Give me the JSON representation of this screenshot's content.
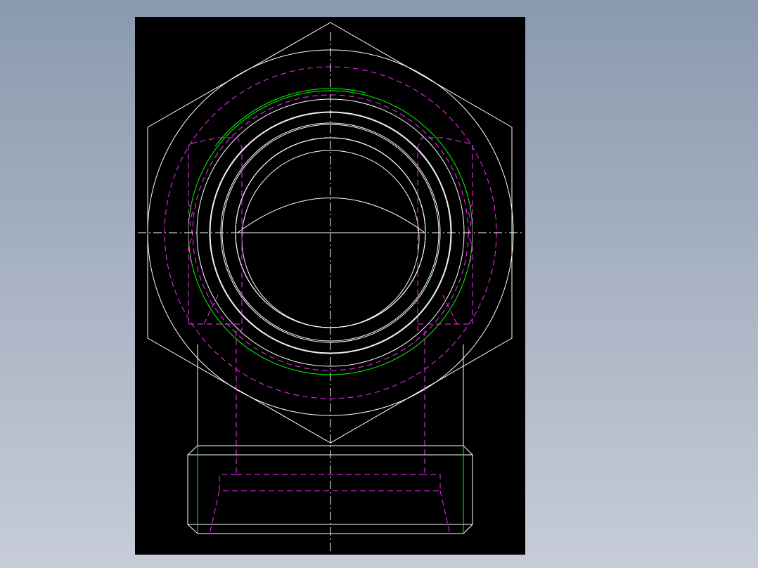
{
  "viewport": {
    "background_top": "#8a9aae",
    "background_bottom": "#c7ccd8"
  },
  "sheet": {
    "fill": "#000000"
  },
  "pens": {
    "outline": "#ffffff",
    "hidden": "#ff2bff",
    "thread": "#00ff00",
    "center": "#ffffff"
  }
}
